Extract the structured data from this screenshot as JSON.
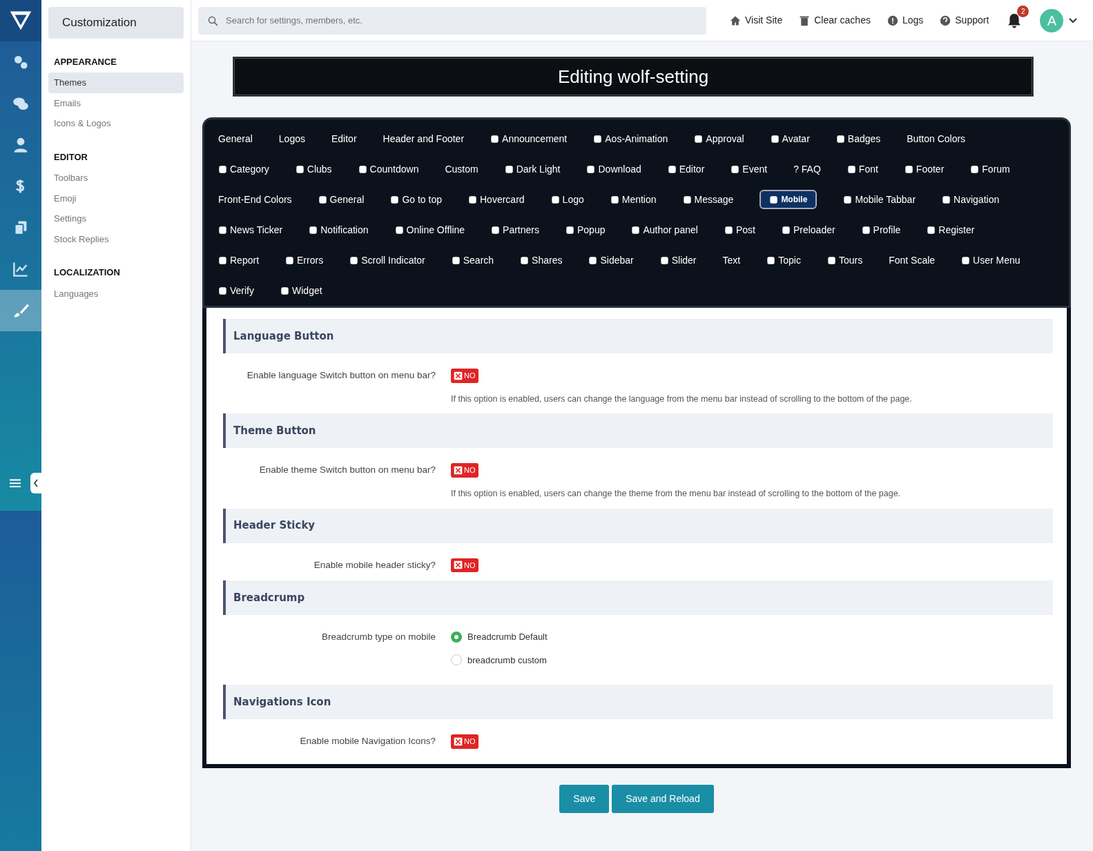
{
  "rail_items": [
    {
      "selected": false
    },
    {
      "selected": false
    },
    {
      "selected": false
    },
    {
      "selected": false
    },
    {
      "selected": false
    },
    {
      "selected": false
    },
    {
      "selected": true
    }
  ],
  "sidebar": {
    "title": "Customization",
    "groups": [
      {
        "heading": "APPEARANCE",
        "items": [
          {
            "label": "Themes",
            "selected": true
          },
          {
            "label": "Emails",
            "selected": false
          },
          {
            "label": "Icons & Logos",
            "selected": false
          }
        ]
      },
      {
        "heading": "EDITOR",
        "items": [
          {
            "label": "Toolbars",
            "selected": false
          },
          {
            "label": "Emoji",
            "selected": false
          },
          {
            "label": "Settings",
            "selected": false
          },
          {
            "label": "Stock Replies",
            "selected": false
          }
        ]
      },
      {
        "heading": "LOCALIZATION",
        "items": [
          {
            "label": "Languages",
            "selected": false
          }
        ]
      }
    ]
  },
  "top_bar": {
    "search": {
      "placeholder": "Search for settings, members, etc."
    },
    "links": [
      {
        "label": "Visit Site",
        "kind": "home"
      },
      {
        "label": "Clear caches",
        "kind": "trash"
      },
      {
        "label": "Logs",
        "kind": "alert"
      },
      {
        "label": "Support",
        "kind": "help"
      }
    ],
    "notifications": {
      "count": "2"
    },
    "avatar": {
      "letter": "A"
    }
  },
  "page_title": "Editing wolf-setting",
  "tab_rows": [
    [
      {
        "label": "General",
        "kind": "plain",
        "selected": false
      },
      {
        "label": "Logos",
        "kind": "plain",
        "selected": false
      },
      {
        "label": "Editor",
        "kind": "plain",
        "selected": false
      },
      {
        "label": "Header and Footer",
        "kind": "plain",
        "selected": false
      },
      {
        "label": "Announcement",
        "kind": "icon",
        "selected": false
      },
      {
        "label": "Aos-Animation",
        "kind": "icon",
        "selected": false
      },
      {
        "label": "Approval",
        "kind": "icon",
        "selected": false
      },
      {
        "label": "Avatar",
        "kind": "icon",
        "selected": false
      },
      {
        "label": "Badges",
        "kind": "icon",
        "selected": false
      },
      {
        "label": "Button Colors",
        "kind": "plain",
        "selected": false
      }
    ],
    [
      {
        "label": "Category",
        "kind": "icon",
        "selected": false
      },
      {
        "label": "Clubs",
        "kind": "icon",
        "selected": false
      },
      {
        "label": "Countdown",
        "kind": "icon",
        "selected": false
      },
      {
        "label": "Custom",
        "kind": "plain",
        "selected": false
      },
      {
        "label": "Dark Light",
        "kind": "icon",
        "selected": false
      },
      {
        "label": "Download",
        "kind": "icon",
        "selected": false
      },
      {
        "label": "Editor",
        "kind": "icon",
        "selected": false
      },
      {
        "label": "Event",
        "kind": "icon",
        "selected": false
      },
      {
        "label": "? FAQ",
        "kind": "plain",
        "selected": false
      },
      {
        "label": "Font",
        "kind": "icon",
        "selected": false
      },
      {
        "label": "Footer",
        "kind": "icon",
        "selected": false
      },
      {
        "label": "Forum",
        "kind": "icon",
        "selected": false
      }
    ],
    [
      {
        "label": "Front-End Colors",
        "kind": "plain",
        "selected": false
      },
      {
        "label": "General",
        "kind": "icon",
        "selected": false
      },
      {
        "label": "Go to top",
        "kind": "icon",
        "selected": false
      },
      {
        "label": "Hovercard",
        "kind": "icon",
        "selected": false
      },
      {
        "label": "Logo",
        "kind": "icon",
        "selected": false
      },
      {
        "label": "Mention",
        "kind": "icon",
        "selected": false
      },
      {
        "label": "Message",
        "kind": "icon",
        "selected": false
      },
      {
        "label": "Mobile",
        "kind": "icon",
        "selected": true
      },
      {
        "label": "Mobile Tabbar",
        "kind": "icon",
        "selected": false
      },
      {
        "label": "Navigation",
        "kind": "icon",
        "selected": false
      }
    ],
    [
      {
        "label": "News Ticker",
        "kind": "icon",
        "selected": false
      },
      {
        "label": "Notification",
        "kind": "icon",
        "selected": false
      },
      {
        "label": "Online Offline",
        "kind": "icon",
        "selected": false
      },
      {
        "label": "Partners",
        "kind": "icon",
        "selected": false
      },
      {
        "label": "Popup",
        "kind": "icon",
        "selected": false
      },
      {
        "label": "Author panel",
        "kind": "icon",
        "selected": false
      },
      {
        "label": "Post",
        "kind": "icon",
        "selected": false
      },
      {
        "label": "Preloader",
        "kind": "icon",
        "selected": false
      },
      {
        "label": "Profile",
        "kind": "icon",
        "selected": false
      },
      {
        "label": "Register",
        "kind": "icon",
        "selected": false
      }
    ],
    [
      {
        "label": "Report",
        "kind": "icon",
        "selected": false
      },
      {
        "label": "Errors",
        "kind": "icon",
        "selected": false
      },
      {
        "label": "Scroll Indicator",
        "kind": "icon",
        "selected": false
      },
      {
        "label": "Search",
        "kind": "icon",
        "selected": false
      },
      {
        "label": "Shares",
        "kind": "icon",
        "selected": false
      },
      {
        "label": "Sidebar",
        "kind": "icon",
        "selected": false
      },
      {
        "label": "Slider",
        "kind": "icon",
        "selected": false
      },
      {
        "label": "Text",
        "kind": "plain",
        "selected": false
      },
      {
        "label": "Topic",
        "kind": "icon",
        "selected": false
      },
      {
        "label": "Tours",
        "kind": "icon",
        "selected": false
      },
      {
        "label": "Font Scale",
        "kind": "plain",
        "selected": false
      },
      {
        "label": "User Menu",
        "kind": "icon",
        "selected": false
      }
    ],
    [
      {
        "label": "Verify",
        "kind": "icon",
        "selected": false
      },
      {
        "label": "Widget",
        "kind": "icon",
        "selected": false
      }
    ]
  ],
  "sections": [
    {
      "title": "Language Button",
      "options": [
        {
          "kind": "toggle",
          "label": "Enable language Switch button on menu bar?",
          "on": false,
          "state_text": "NO",
          "hint": "If this option is enabled, users can change the language from the menu bar instead of scrolling to the bottom of the page."
        }
      ]
    },
    {
      "title": "Theme Button",
      "options": [
        {
          "kind": "toggle",
          "label": "Enable theme Switch button on menu bar?",
          "on": false,
          "state_text": "NO",
          "hint": "If this option is enabled, users can change the theme from the menu bar instead of scrolling to the bottom of the page."
        }
      ]
    },
    {
      "title": "Header Sticky",
      "options": [
        {
          "kind": "toggle",
          "label": "Enable mobile header sticky?",
          "on": false,
          "state_text": "NO"
        }
      ]
    },
    {
      "title": "Breadcrump",
      "options": [
        {
          "kind": "radio",
          "label": "Breadcrumb type on mobile",
          "choices": [
            {
              "label": "Breadcrumb Default",
              "selected": true
            },
            {
              "label": "breadcrumb custom",
              "selected": false
            }
          ]
        }
      ]
    },
    {
      "title": "Navigations Icon",
      "options": [
        {
          "kind": "toggle",
          "label": "Enable mobile Navigation Icons?",
          "on": false,
          "state_text": "NO"
        }
      ]
    }
  ],
  "buttons": [
    {
      "label": "Save"
    },
    {
      "label": "Save and Reload"
    }
  ]
}
